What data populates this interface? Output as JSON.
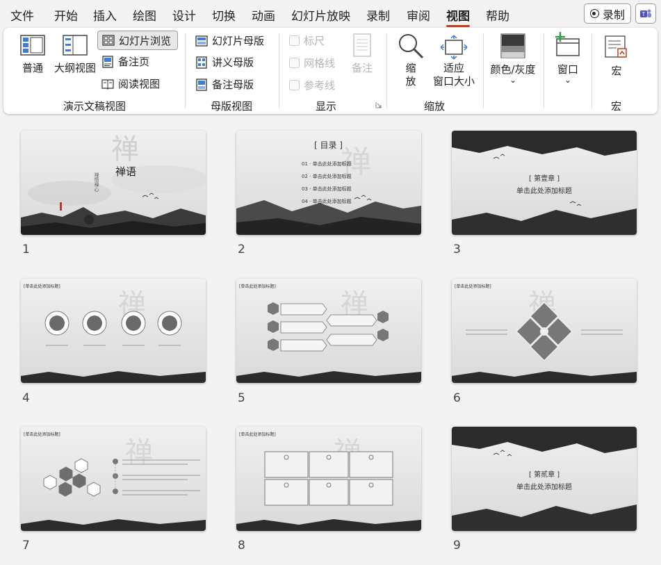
{
  "menu": {
    "items": [
      "文件",
      "开始",
      "插入",
      "绘图",
      "设计",
      "切换",
      "动画",
      "幻灯片放映",
      "录制",
      "审阅",
      "视图",
      "帮助"
    ],
    "active": "视图",
    "record_label": "录制"
  },
  "ribbon": {
    "groups": {
      "presentation_views": "演示文稿视图",
      "master_views": "母版视图",
      "show": "显示",
      "zoom": "缩放",
      "macros": "宏"
    },
    "normal": "普通",
    "outline": "大纲视图",
    "slide_sorter": "幻灯片浏览",
    "notes_page": "备注页",
    "reading_view": "阅读视图",
    "slide_master": "幻灯片母版",
    "handout_master": "讲义母版",
    "notes_master": "备注母版",
    "ruler": "标尺",
    "gridlines": "网格线",
    "guides": "参考线",
    "notes": "备注",
    "zoom_l1": "缩",
    "zoom_l2": "放",
    "fit_l1": "适应",
    "fit_l2": "窗口大小",
    "color_grayscale": "颜色/灰度",
    "window": "窗口",
    "macros": "宏",
    "dropdown_arrow": "⌄"
  },
  "slides": {
    "numbers": [
      "1",
      "2",
      "3",
      "4",
      "5",
      "6",
      "7",
      "8",
      "9"
    ],
    "s1": {
      "title": "禅语",
      "sub": "禅悟禅心"
    },
    "s2": {
      "heading": "[ 目录 ]",
      "items": [
        "01 · 单击此处添加标题",
        "02 · 单击此处添加标题",
        "03 · 单击此处添加标题",
        "04 · 单击此处添加标题"
      ]
    },
    "s3": {
      "chapter": "[ 第壹章 ]",
      "title": "单击此处添加标题"
    },
    "s9": {
      "chapter": "[ 第贰章 ]",
      "title": "单击此处添加标题"
    },
    "content_title": "[单击此处添加标题]"
  },
  "colors": {
    "accent": "#c43e1c",
    "ink": "#3a3a3a",
    "slide_bg": "#e6e6e6"
  }
}
